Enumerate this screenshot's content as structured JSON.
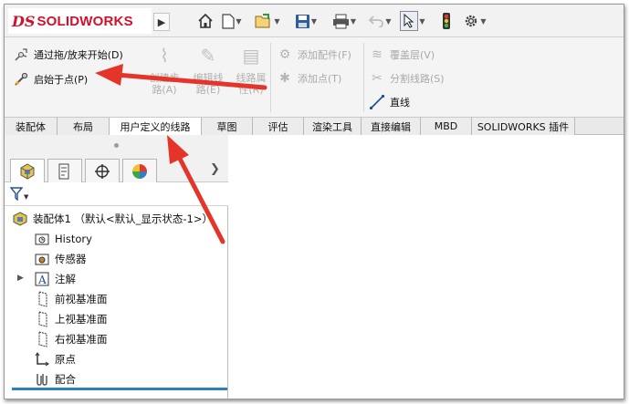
{
  "app": {
    "logo_mark": "DS",
    "logo_text": "SOLIDWORKS",
    "expand_icon": "triangle-right-icon"
  },
  "quick_access": [
    {
      "name": "home-icon"
    },
    {
      "name": "new-document-icon"
    },
    {
      "name": "open-icon"
    },
    {
      "name": "save-icon"
    },
    {
      "name": "print-icon"
    },
    {
      "name": "undo-icon"
    },
    {
      "name": "select-icon"
    },
    {
      "name": "rebuild-traffic-light-icon"
    },
    {
      "name": "options-gear-icon"
    }
  ],
  "ribbon": {
    "drag_start": "通过拖/放来开始(D)",
    "start_at_point": "启始于点(P)",
    "create_route": "创建步\n路(A)",
    "edit_route": "编辑线\n路(E)",
    "route_properties": "线路属\n性(R)",
    "add_fitting": "添加配件(F)",
    "add_point": "添加点(T)",
    "cover_layer": "覆盖层(V)",
    "split_route": "分割线路(S)",
    "line": "直线"
  },
  "tabs": [
    {
      "label": "装配体",
      "active": false
    },
    {
      "label": "布局",
      "active": false
    },
    {
      "label": "用户定义的线路",
      "active": true
    },
    {
      "label": "草图",
      "active": false
    },
    {
      "label": "评估",
      "active": false
    },
    {
      "label": "渲染工具",
      "active": false
    },
    {
      "label": "直接编辑",
      "active": false
    },
    {
      "label": "MBD",
      "active": false
    },
    {
      "label": "SOLIDWORKS 插件",
      "active": false
    }
  ],
  "panel": {
    "tabs": [
      {
        "name": "featuremanager-tab-icon"
      },
      {
        "name": "propertymanager-tab-icon"
      },
      {
        "name": "configurationmanager-tab-icon"
      },
      {
        "name": "appearance-tab-icon"
      }
    ],
    "more_icon": "chevron-right-icon",
    "filter_icon": "filter-icon"
  },
  "tree": {
    "root": "装配体1 （默认<默认_显示状态-1>）",
    "items": [
      {
        "label": "History",
        "icon": "history-folder-icon"
      },
      {
        "label": "传感器",
        "icon": "sensor-folder-icon"
      },
      {
        "label": "注解",
        "icon": "annotation-icon"
      },
      {
        "label": "前视基准面",
        "icon": "plane-icon"
      },
      {
        "label": "上视基准面",
        "icon": "plane-icon"
      },
      {
        "label": "右视基准面",
        "icon": "plane-icon"
      },
      {
        "label": "原点",
        "icon": "origin-icon"
      },
      {
        "label": "配合",
        "icon": "mates-icon"
      }
    ]
  },
  "colors": {
    "brand_red": "#d2102c",
    "annotation_red": "#e5352b",
    "selection_blue": "#2a7ec1"
  }
}
